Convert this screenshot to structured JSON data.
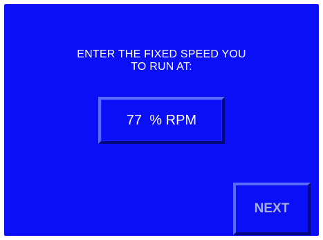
{
  "prompt": {
    "line1": "ENTER THE FIXED SPEED YOU",
    "line2": "TO RUN AT:"
  },
  "speed_input": {
    "value": "77",
    "unit": "% RPM"
  },
  "next_button": {
    "label": "NEXT"
  },
  "colors": {
    "background": "#0a0ff5",
    "text": "#ffffff",
    "next_label": "#a6b0d8"
  }
}
